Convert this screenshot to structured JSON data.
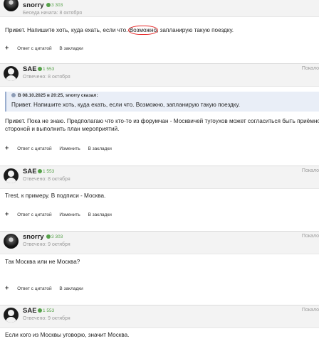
{
  "posts": [
    {
      "author": "snorry",
      "rep": "3 303",
      "sub": "Беседа начата: 8 октября",
      "corner": "",
      "avatar": "snorry",
      "body_before": "Привет. Напишите хоть, куда ехать, если что. ",
      "body_circled": "Возможно",
      "body_after": ", запланирую такую поездку.",
      "actions": {
        "plus": "+",
        "quote": "Ответ с цитатой",
        "edit": "",
        "bookmark": "В закладки"
      }
    },
    {
      "author": "SAE",
      "rep": "1 553",
      "sub": "Отвечено: 8 октября",
      "corner": "Покало",
      "avatar": "sae",
      "quote_head": "В 08.10.2025 в 20:25, snorry сказал:",
      "quote_text": "Привет. Напишите хоть, куда ехать, если что. Возможно, запланирую такую поездку.",
      "body_line1": "Привет. Пока не знаю. Предполагаю что кто-то из форумчан - Москвичей тугоухов может согласиться быть приёмной",
      "body_line2": "стороной и выполнить план мероприятий.",
      "actions": {
        "plus": "+",
        "quote": "Ответ с цитатой",
        "edit": "Изменить",
        "bookmark": "В закладки"
      }
    },
    {
      "author": "SAE",
      "rep": "1 553",
      "sub": "Отвечено: 8 октября",
      "corner": "Покало",
      "avatar": "sae",
      "body": "Trest,  к примеру. В подписи - Москва.",
      "actions": {
        "plus": "+",
        "quote": "Ответ с цитатой",
        "edit": "Изменить",
        "bookmark": "В закладки"
      }
    },
    {
      "author": "snorry",
      "rep": "3 303",
      "sub": "Отвечено: 9 октября",
      "corner": "Покало",
      "avatar": "snorry",
      "body": "Так Москва или не Москва?",
      "actions": {
        "plus": "+",
        "quote": "Ответ с цитатой",
        "edit": "",
        "bookmark": "В закладки"
      }
    },
    {
      "author": "SAE",
      "rep": "1 553",
      "sub": "Отвечено: 9 октября",
      "corner": "Покало",
      "avatar": "sae",
      "body": "Если кого из Москвы уговорю, значит Москва.",
      "actions": {}
    }
  ],
  "colors": {
    "accent_red": "#e52424",
    "rep_green": "#56a14a",
    "quote_bg": "#e9eef7"
  }
}
